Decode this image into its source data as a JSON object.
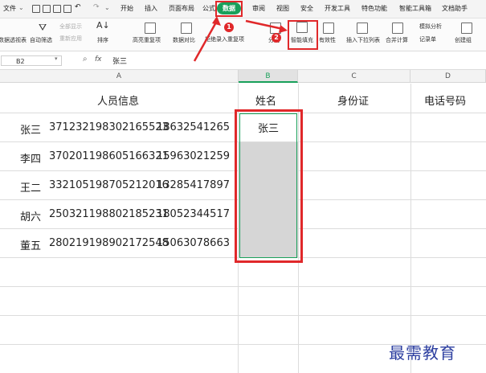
{
  "menu": {
    "file": "文件",
    "tabs": [
      "开始",
      "插入",
      "页面布局",
      "公式",
      "数据",
      "审阅",
      "视图",
      "安全",
      "开发工具",
      "特色功能",
      "智能工具箱",
      "文档助手"
    ],
    "active_tab": "数据"
  },
  "ribbon": {
    "pivot_table": "数据透视表",
    "auto_filter": "自动筛选",
    "show_all": "全部显示",
    "reapply": "重新应用",
    "sort": "排序",
    "highlight_duplicates": "高亮重复项",
    "data_compare": "数据对比",
    "reject_duplicates": "拒绝录入重复项",
    "split_column": "分列",
    "smart_fill": "智能填充",
    "validity": "有效性",
    "insert_dropdown": "插入下拉列表",
    "consolidate": "合并计算",
    "simulation": "模拟分析",
    "record_sheet": "记录单",
    "create_group": "创建组"
  },
  "formula_bar": {
    "cell_ref": "B2",
    "fx": "fx",
    "value": "张三"
  },
  "columns": [
    "A",
    "B",
    "C",
    "D"
  ],
  "header_row": {
    "a": "人员信息",
    "b": "姓名",
    "c": "身份证",
    "d": "电话号码"
  },
  "rows": [
    {
      "name": "张三",
      "id": "371232198302165523",
      "phone": "18632541265",
      "b": "张三"
    },
    {
      "name": "李四",
      "id": "370201198605166321",
      "phone": "15963021259",
      "b": ""
    },
    {
      "name": "王二",
      "id": "332105198705212016",
      "phone": "13285417897",
      "b": ""
    },
    {
      "name": "胡六",
      "id": "250321198802185231",
      "phone": "18052344517",
      "b": ""
    },
    {
      "name": "董五",
      "id": "280219198902172548",
      "phone": "15063078663",
      "b": ""
    }
  ],
  "annotations": {
    "step1": "1",
    "step2": "2"
  },
  "watermark": "最需教育",
  "colors": {
    "accent_green": "#19a05a",
    "highlight_red": "#e0282a",
    "selection_grey": "#d6d6d6"
  }
}
